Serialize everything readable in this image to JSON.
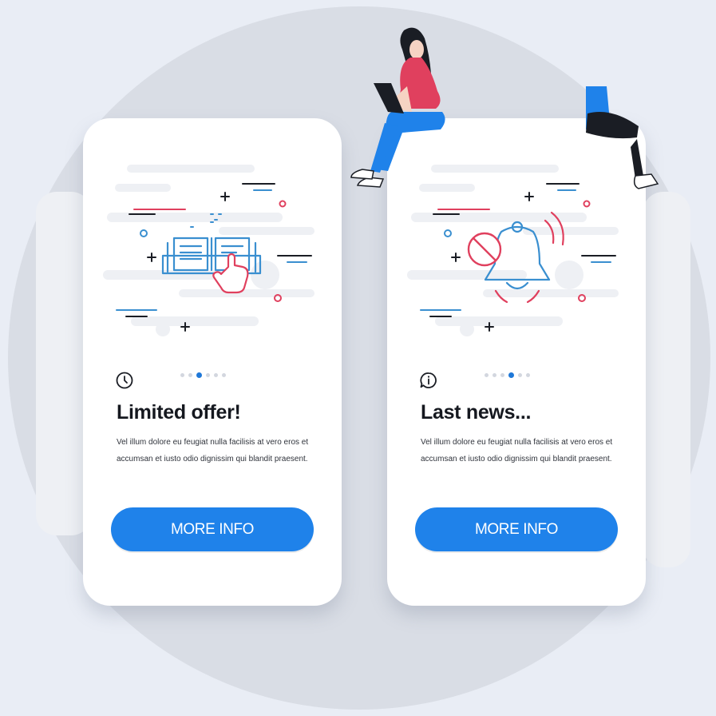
{
  "cards": [
    {
      "title": "Limited offer!",
      "body": "Vel illum dolore eu feugiat nulla facilisis at vero eros et accumsan et iusto odio dignissim qui blandit praesent.",
      "button_label": "MORE INFO",
      "icon": "clock-icon",
      "illustration": "open-book-with-pointing-hand",
      "pager_active_index": 2,
      "pager_count": 6
    },
    {
      "title": "Last news...",
      "body": "Vel illum dolore eu feugiat nulla facilisis at vero eros et accumsan et iusto odio dignissim qui blandit praesent.",
      "button_label": "MORE INFO",
      "icon": "info-speech-bubble-icon",
      "illustration": "muted-bell-notification",
      "pager_active_index": 3,
      "pager_count": 6
    }
  ],
  "colors": {
    "accent": "#1f82ea",
    "pager_active": "#1f78d8",
    "line_blue": "#3a8fd0",
    "line_red": "#e0405e",
    "background_circle": "#d9dde5"
  }
}
